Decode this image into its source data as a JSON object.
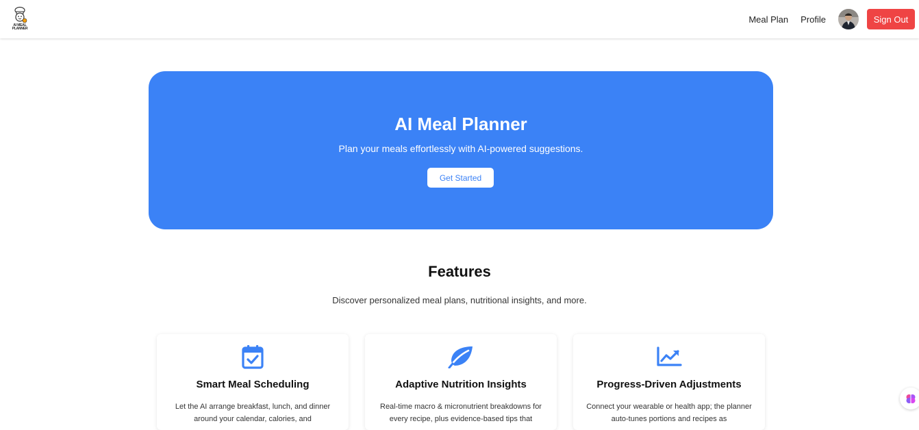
{
  "header": {
    "logo_text_1": "AI MEAL",
    "logo_text_2": "PLANNER",
    "nav": {
      "meal_plan": "Meal Plan",
      "profile": "Profile",
      "sign_out": "Sign Out"
    }
  },
  "hero": {
    "title": "AI Meal Planner",
    "subtitle": "Plan your meals effortlessly with AI-powered suggestions.",
    "cta": "Get Started"
  },
  "features": {
    "title": "Features",
    "subtitle": "Discover personalized meal plans, nutritional insights, and more.",
    "cards": [
      {
        "icon": "calendar-check-icon",
        "title": "Smart Meal Scheduling",
        "description": "Let the AI arrange breakfast, lunch, and dinner around your calendar, calories, and"
      },
      {
        "icon": "leaf-icon",
        "title": "Adaptive Nutrition Insights",
        "description": "Real-time macro & micronutrient breakdowns for every recipe, plus evidence-based tips that"
      },
      {
        "icon": "trending-up-icon",
        "title": "Progress-Driven Adjustments",
        "description": "Connect your wearable or health app; the planner auto-tunes portions and recipes as"
      }
    ]
  },
  "colors": {
    "accent": "#3b82f6",
    "danger": "#ef4444"
  }
}
